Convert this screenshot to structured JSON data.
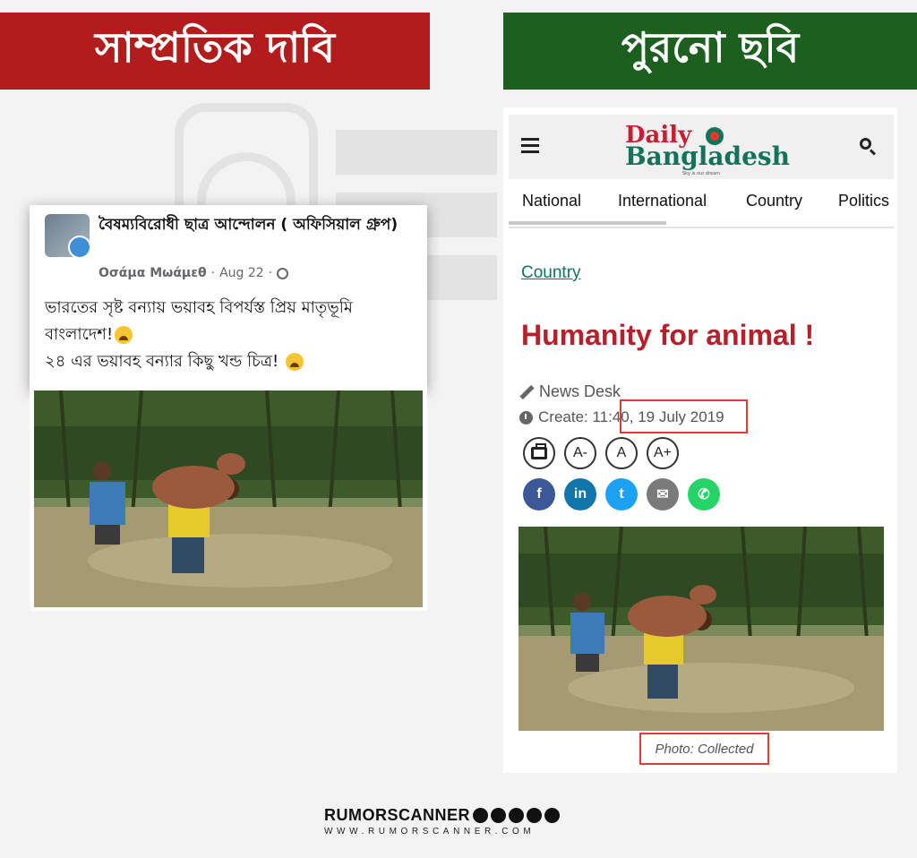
{
  "banners": {
    "left": "সাম্প্রতিক দাবি",
    "right": "পুরনো ছবি"
  },
  "facebook_post": {
    "group_name": "বৈষম্যবিরোধী ছাত্র আন্দোলন ( অফিসিয়াল গ্রুপ)",
    "author": "Οσάμα Μωάμεθ",
    "date": "Aug 22",
    "separator": "·",
    "text_line1": "ভারতের সৃষ্ট বন্যায় ভয়াবহ বিপর্যস্ত প্রিয় মাতৃভূমি বাংলাদেশ!",
    "text_line2": "২৪ এর ভয়াবহ বন্যার কিছু খন্ড চিত্র!"
  },
  "news_site": {
    "logo_line1": "Daily",
    "logo_line2": "Bangladesh",
    "logo_tagline": "Sky is our dream",
    "nav": [
      "National",
      "International",
      "Country",
      "Politics"
    ],
    "category": "Country",
    "headline": "Humanity for animal !",
    "byline": "News Desk",
    "created": "Create: 11:40, 19 July 2019",
    "font_buttons": [
      "A-",
      "A",
      "A+"
    ],
    "share": [
      {
        "label": "f",
        "color": "#3b5998"
      },
      {
        "label": "in",
        "color": "#0e76a8"
      },
      {
        "label": "t",
        "color": "#1da1f2"
      },
      {
        "label": "✉",
        "color": "#7a7a7a"
      },
      {
        "label": "✆",
        "color": "#25d366"
      }
    ],
    "photo_caption": "Photo: Collected"
  },
  "footer": {
    "brand": "RUMORSCANNER",
    "url": "WWW.RUMORSCANNER.COM"
  },
  "colors": {
    "red_banner": "#b21c1c",
    "green_banner": "#1c5f1f",
    "headline": "#b5202a",
    "highlight_box": "#e23b35"
  }
}
